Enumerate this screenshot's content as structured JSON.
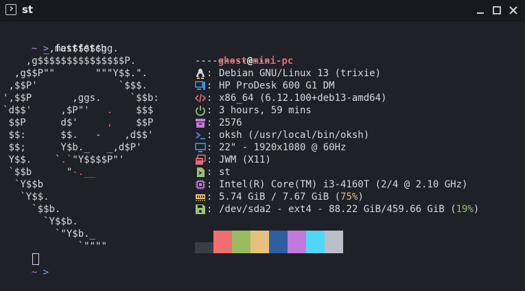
{
  "window": {
    "title": "st"
  },
  "prompt": {
    "tilde": "~",
    "arrow": ">",
    "command": "fastfetch"
  },
  "logo_lines": [
    "       _,met$$$$$gg.",
    "    ,g$$$$$$$$$$$$$$$P.",
    "  ,g$$P\"\"       \"\"\"Y$$.\".",
    " ,$$P'              `$$$.",
    "',$$P       ,ggs.     `$$b:",
    "`d$$'     ,$P\"'   .    $$$",
    " $$P      d$'     ,    $$P",
    " $$:      $$.   -    ,d$$'",
    " $$;      Y$b._   _,d$P'",
    " Y$$.    `.`\"Y$$$$P\"'",
    " `$$b      \"-.__",
    "  `Y$$b",
    "   `Y$$.",
    "     `$$b.",
    "       `Y$$b.",
    "         `\"Y$b._",
    "             `\"\"\"\""
  ],
  "header": {
    "user": "ghost",
    "at": "@",
    "host": "mini-pc",
    "separator": "-------------"
  },
  "info": [
    {
      "icon": "linux-penguin-icon",
      "value": "Debian GNU/Linux 13 (trixie)"
    },
    {
      "icon": "computer-host-icon",
      "value": "HP ProDesk 600 G1 DM"
    },
    {
      "icon": "kernel-code-icon",
      "value": "x86_64 (6.12.100+deb13-amd64)"
    },
    {
      "icon": "uptime-power-icon",
      "value": "3 hours, 59 mins"
    },
    {
      "icon": "packages-box-icon",
      "value": "2576"
    },
    {
      "icon": "shell-prompt-icon",
      "value": "oksh (/usr/local/bin/oksh)"
    },
    {
      "icon": "display-monitor-icon",
      "value": "22\" - 1920x1080 @ 60Hz"
    },
    {
      "icon": "window-manager-icon",
      "value": "JWM (X11)"
    },
    {
      "icon": "terminal-file-icon",
      "value": "st"
    },
    {
      "icon": "cpu-chip-icon",
      "value": "Intel(R) Core(TM) i3-4160T (2/4 @ 2.10 GHz)"
    },
    {
      "icon": "memory-ram-icon",
      "value": "5.74 GiB / 7.67 GiB (",
      "pct": "75%",
      "tail": ")"
    },
    {
      "icon": "disk-save-icon",
      "value": "/dev/sda2 - ext4 - 88.22 GiB/459.66 GiB (",
      "pct": "19%",
      "tail": ")"
    }
  ],
  "palette": [
    "#3a3d44",
    "#f26d6d",
    "#9bbb63",
    "#e8c07d",
    "#2f5ea3",
    "#c278dd",
    "#4fd7f5",
    "#b9bec8"
  ],
  "colors": {
    "background": "#1e2127",
    "accent_red": "#e06c75",
    "icon_color": "#4f8fd8",
    "titlebar": "#17191d"
  },
  "bottom_prompt": {
    "tilde": "~",
    "arrow": ">"
  }
}
